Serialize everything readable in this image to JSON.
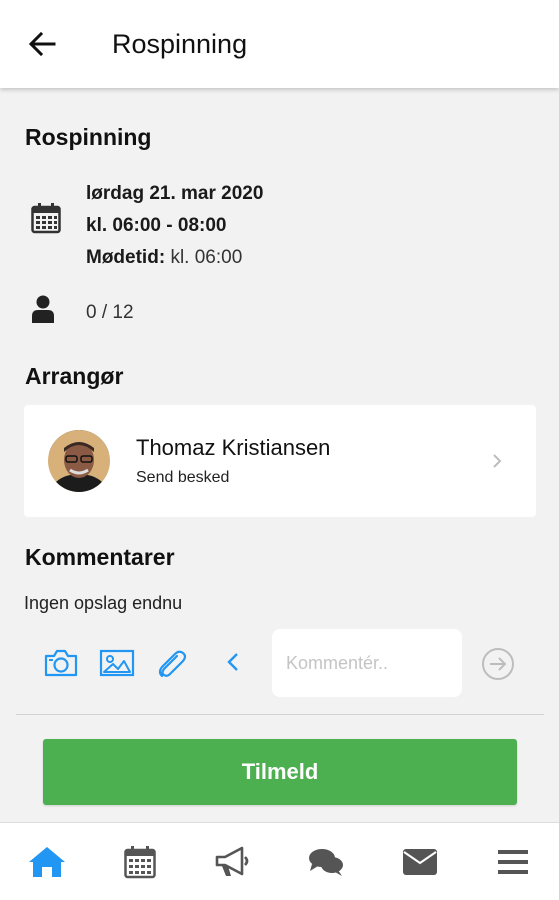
{
  "appbar": {
    "back_icon": "arrow-left-icon",
    "title": "Rospinning"
  },
  "event": {
    "title": "Rospinning",
    "date": "lørdag 21. mar 2020",
    "time": "kl. 06:00 - 08:00",
    "meet_label": "Mødetid:",
    "meet_value": "kl. 06:00",
    "participants": "0 / 12"
  },
  "organizer": {
    "section_title": "Arrangør",
    "name": "Thomaz Kristiansen",
    "action": "Send besked"
  },
  "comments": {
    "section_title": "Kommentarer",
    "empty_text": "Ingen opslag endnu",
    "input_placeholder": "Kommentér..",
    "input_value": ""
  },
  "join_button": "Tilmeld",
  "bottom_nav": {
    "items": [
      "home-icon",
      "calendar-icon",
      "megaphone-icon",
      "chat-icon",
      "mail-icon",
      "menu-icon"
    ],
    "active": "home-icon"
  },
  "colors": {
    "accent_blue": "#2196f3",
    "join_green": "#4caf50",
    "icon_gray": "#555555",
    "background": "#f2f2f2"
  }
}
